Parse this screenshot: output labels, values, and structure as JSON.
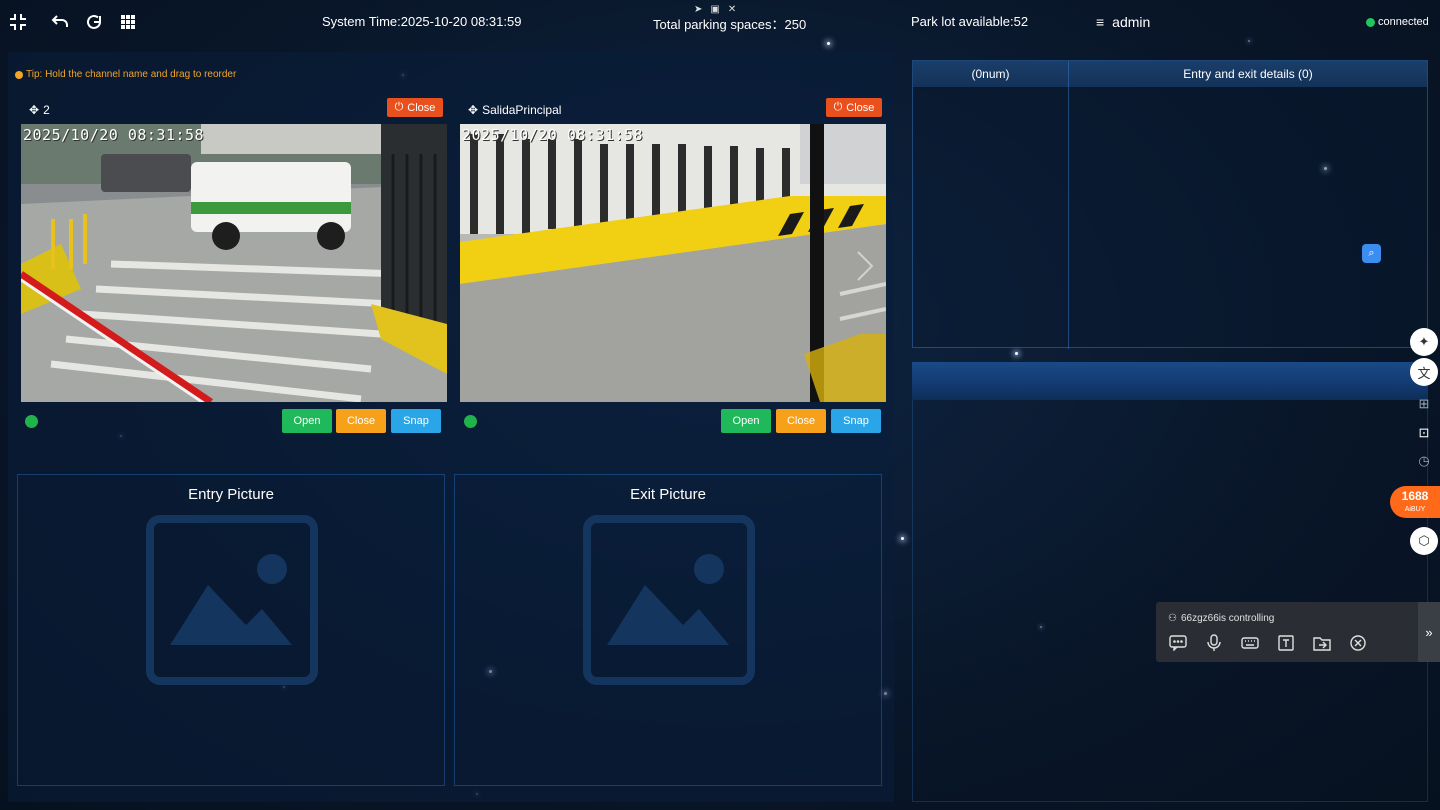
{
  "topbar": {
    "system_time": "System Time:2025-10-20 08:31:59",
    "total_spaces": "Total parking spaces：250",
    "available": "Park lot available:52",
    "user": "admin",
    "connection": "connected",
    "icons": [
      "compress-icon",
      "undo-icon",
      "refresh-icon",
      "grid-icon"
    ]
  },
  "tip": "Tip: Hold the channel name and drag to reorder",
  "cameras": [
    {
      "name": "2",
      "close_label": "Close",
      "timestamp": "2025/10/20 08:31:58",
      "buttons": {
        "open": "Open",
        "close": "Close",
        "snap": "Snap"
      },
      "status_color": "#22b24c"
    },
    {
      "name": "SalidaPrincipal",
      "close_label": "Close",
      "timestamp": "2025/10/20 08:31:58",
      "buttons": {
        "open": "Open",
        "close": "Close",
        "snap": "Snap"
      },
      "status_color": "#22b24c"
    }
  ],
  "pictures": {
    "entry_title": "Entry Picture",
    "exit_title": "Exit Picture"
  },
  "details": {
    "col1": "(0num)",
    "col2": "Entry and exit details  (0)"
  },
  "sidetool": {
    "badge_top": "1688",
    "badge_bottom": "AiBUY"
  },
  "remote": {
    "user": "66zgz66is controlling",
    "icons": [
      "chat-icon",
      "microphone-icon",
      "keyboard-icon",
      "text-icon",
      "file-transfer-icon",
      "close-circle-icon"
    ]
  },
  "colors": {
    "close": "#e8501e",
    "open": "#1fb85a",
    "close_gate": "#f7a11a",
    "snap": "#2aa6e8",
    "tip": "#f5a524"
  }
}
